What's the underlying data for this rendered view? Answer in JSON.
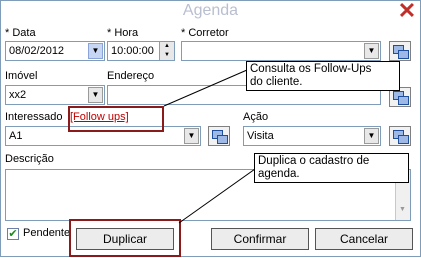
{
  "window": {
    "title": "Agenda",
    "close_icon": "close-x-icon"
  },
  "labels": {
    "data": "* Data",
    "hora": "* Hora",
    "corretor": "* Corretor",
    "imovel": "Imóvel",
    "endereco": "Endereço",
    "interessado": "Interessado",
    "acao": "Ação",
    "descricao": "Descrição"
  },
  "fields": {
    "data": "08/02/2012",
    "hora": "10:00:00",
    "corretor": "",
    "imovel": "xx2",
    "endereco": "",
    "interessado": "A1",
    "acao": "Visita",
    "descricao": ""
  },
  "links": {
    "follow_ups": "[Follow ups]"
  },
  "checkbox": {
    "pendente_label": "Pendente",
    "pendente_checked": true
  },
  "buttons": {
    "duplicar": "Duplicar",
    "confirmar": "Confirmar",
    "cancelar": "Cancelar"
  },
  "callouts": {
    "follow_ups_line1": "Consulta os Follow-Ups",
    "follow_ups_line2": "do cliente.",
    "duplicar_line1": "Duplica o cadastro de",
    "duplicar_line2": "agenda."
  },
  "colors": {
    "close": "#c0302a",
    "link": "#c00000",
    "highlight_frame": "#8b1a1a",
    "title": "#b8bfd0"
  }
}
